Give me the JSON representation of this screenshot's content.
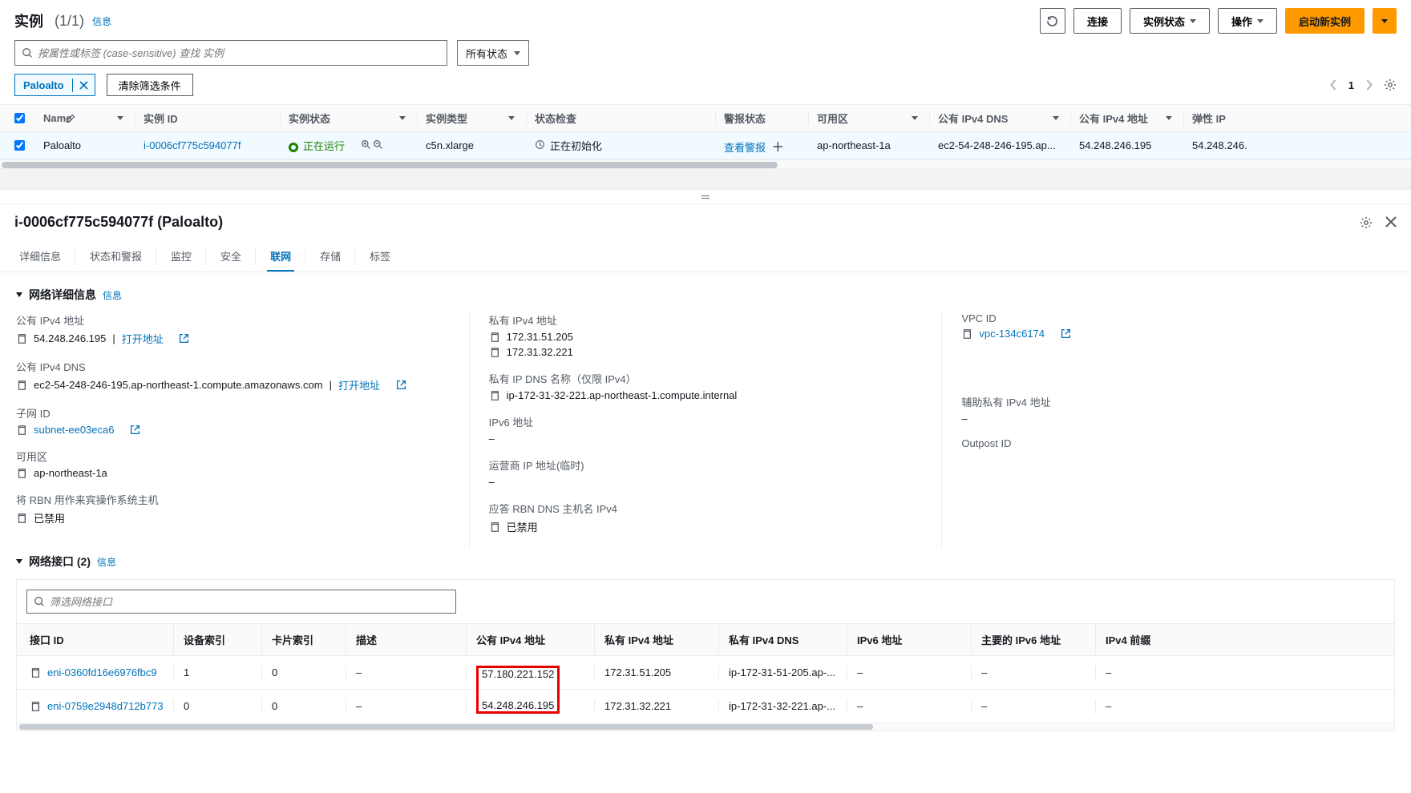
{
  "header": {
    "title": "实例",
    "count": "(1/1)",
    "info": "信息",
    "connect": "连接",
    "stateMenu": "实例状态",
    "actions": "操作",
    "launch": "启动新实例"
  },
  "search": {
    "placeholder": "按属性或标签 (case-sensitive) 查找 实例",
    "allStates": "所有状态"
  },
  "filter": {
    "chip": "Paloalto",
    "clear": "清除筛选条件",
    "page": "1"
  },
  "columns": {
    "name": "Name",
    "id": "实例 ID",
    "state": "实例状态",
    "type": "实例类型",
    "check": "状态检查",
    "alarm": "警报状态",
    "az": "可用区",
    "dns": "公有 IPv4 DNS",
    "pubip": "公有 IPv4 地址",
    "eip": "弹性 IP"
  },
  "row": {
    "name": "Paloalto",
    "id": "i-0006cf775c594077f",
    "state": "正在运行",
    "type": "c5n.xlarge",
    "check": "正在初始化",
    "alarm": "查看警报",
    "az": "ap-northeast-1a",
    "dns": "ec2-54-248-246-195.ap...",
    "pubip": "54.248.246.195",
    "eip": "54.248.246."
  },
  "detail": {
    "title": "i-0006cf775c594077f (Paloalto)",
    "tabs": {
      "details": "详细信息",
      "status": "状态和警报",
      "monitor": "监控",
      "security": "安全",
      "network": "联网",
      "storage": "存储",
      "tags": "标签"
    }
  },
  "net": {
    "sectionTitle": "网络详细信息",
    "info": "信息",
    "publicIPv4": {
      "label": "公有 IPv4 地址",
      "value": "54.248.246.195",
      "open": "打开地址"
    },
    "privateIPv4": {
      "label": "私有 IPv4 地址",
      "ip1": "172.31.51.205",
      "ip2": "172.31.32.221"
    },
    "vpc": {
      "label": "VPC ID",
      "value": "vpc-134c6174"
    },
    "publicDNS": {
      "label": "公有 IPv4 DNS",
      "value": "ec2-54-248-246-195.ap-northeast-1.compute.amazonaws.com",
      "open": "打开地址"
    },
    "privateDNS": {
      "label": "私有 IP DNS 名称（仅限 IPv4）",
      "value": "ip-172-31-32-221.ap-northeast-1.compute.internal"
    },
    "subnet": {
      "label": "子网 ID",
      "value": "subnet-ee03eca6"
    },
    "ipv6": {
      "label": "IPv6 地址",
      "value": "–"
    },
    "secPriv": {
      "label": "辅助私有 IPv4 地址",
      "value": "–"
    },
    "azField": {
      "label": "可用区",
      "value": "ap-northeast-1a"
    },
    "carrier": {
      "label": "运营商 IP 地址(临时)",
      "value": "–"
    },
    "outpost": {
      "label": "Outpost ID",
      "value": ""
    },
    "rbn": {
      "label": "将 RBN 用作来宾操作系统主机",
      "value": "已禁用"
    },
    "rbnDns": {
      "label": "应答 RBN DNS 主机名 IPv4",
      "value": "已禁用"
    }
  },
  "ni": {
    "sectionTitle": "网络接口 (2)",
    "info": "信息",
    "searchPlaceholder": "筛选网络接口",
    "cols": {
      "id": "接口 ID",
      "dev": "设备索引",
      "card": "卡片索引",
      "desc": "描述",
      "pub": "公有 IPv4 地址",
      "priv": "私有 IPv4 地址",
      "pdns": "私有 IPv4 DNS",
      "v6": "IPv6 地址",
      "mv6": "主要的 IPv6 地址",
      "pref": "IPv4 前缀"
    },
    "rows": [
      {
        "id": "eni-0360fd16e6976fbc9",
        "dev": "1",
        "card": "0",
        "desc": "–",
        "pub": "57.180.221.152",
        "priv": "172.31.51.205",
        "pdns": "ip-172-31-51-205.ap-...",
        "v6": "–",
        "mv6": "–",
        "pref": "–"
      },
      {
        "id": "eni-0759e2948d712b773",
        "dev": "0",
        "card": "0",
        "desc": "–",
        "pub": "54.248.246.195",
        "priv": "172.31.32.221",
        "pdns": "ip-172-31-32-221.ap-...",
        "v6": "–",
        "mv6": "–",
        "pref": "–"
      }
    ]
  }
}
